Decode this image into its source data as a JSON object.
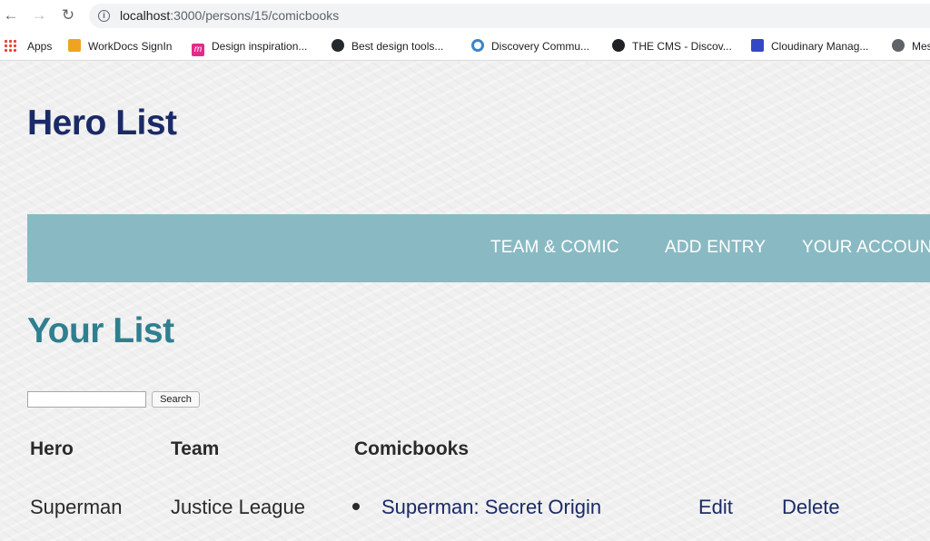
{
  "browser": {
    "url_host": "localhost",
    "url_path": ":3000/persons/15/comicbooks",
    "bookmarks": [
      {
        "label": "Apps",
        "icon": "apps-grid-icon"
      },
      {
        "label": "WorkDocs SignIn",
        "icon": "workdocs-icon"
      },
      {
        "label": "Design inspiration...",
        "icon": "design-icon"
      },
      {
        "label": "Best design tools...",
        "icon": "github-icon"
      },
      {
        "label": "Discovery Commu...",
        "icon": "discovery-icon"
      },
      {
        "label": "THE CMS - Discov...",
        "icon": "cms-icon"
      },
      {
        "label": "Cloudinary Manag...",
        "icon": "cloudinary-icon"
      },
      {
        "label": "Mes",
        "icon": "globe-icon"
      }
    ]
  },
  "site": {
    "title": "Hero List",
    "nav": [
      "TEAM & COMIC",
      "ADD ENTRY",
      "YOUR ACCOUN"
    ]
  },
  "main": {
    "heading": "Your List",
    "search": {
      "value": "",
      "button_label": "Search"
    },
    "table": {
      "headers": [
        "Hero",
        "Team",
        "Comicbooks"
      ],
      "rows": [
        {
          "hero": "Superman",
          "team": "Justice League",
          "comicbook": "Superman: Secret Origin",
          "edit_label": "Edit",
          "delete_label": "Delete"
        }
      ]
    }
  },
  "colors": {
    "title": "#1a2a66",
    "nav_background": "#89bac3",
    "heading": "#2f7f8f",
    "link": "#1a2a66"
  }
}
